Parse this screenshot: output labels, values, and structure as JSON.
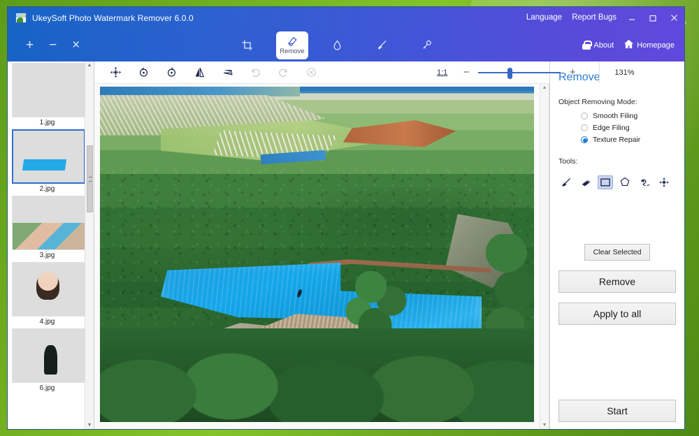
{
  "window": {
    "title": "UkeySoft Photo Watermark Remover 6.0.0",
    "app_icon": "photo-icon",
    "title_links": [
      "Language",
      "Report Bugs"
    ],
    "controls": {
      "minimize": "minimize-icon",
      "maximize": "maximize-icon",
      "close": "close-icon"
    },
    "accent_blue": "#1763c6",
    "accent_purple": "#5f49dc"
  },
  "navbar": {
    "file_ops": [
      {
        "name": "add-files-button",
        "glyph": "+"
      },
      {
        "name": "remove-file-button",
        "glyph": "−"
      },
      {
        "name": "clear-all-button",
        "glyph": "×"
      }
    ],
    "tabs": [
      {
        "id": "crop",
        "label": "",
        "icon": "crop-icon",
        "active": false
      },
      {
        "id": "remove",
        "label": "Remove",
        "icon": "eraser-icon",
        "active": true
      },
      {
        "id": "blur",
        "label": "",
        "icon": "droplet-icon",
        "active": false
      },
      {
        "id": "brush",
        "label": "",
        "icon": "brush-icon",
        "active": false
      },
      {
        "id": "key",
        "label": "",
        "icon": "key-icon",
        "active": false
      }
    ],
    "right_links": [
      {
        "label": "About",
        "icon": "lock-icon"
      },
      {
        "label": "Homepage",
        "icon": "home-icon"
      }
    ]
  },
  "thumbnails": {
    "items": [
      {
        "name": "1.jpg",
        "selected": false,
        "art": "t1"
      },
      {
        "name": "2.jpg",
        "selected": true,
        "art": "t2"
      },
      {
        "name": "3.jpg",
        "selected": false,
        "art": "t3"
      },
      {
        "name": "4.jpg",
        "selected": false,
        "art": "t4"
      },
      {
        "name": "6.jpg",
        "selected": false,
        "art": "t6"
      }
    ],
    "scroll_up": "▲",
    "scroll_down": "▼"
  },
  "canvas_toolbar": {
    "buttons": [
      {
        "name": "pan-tool-button",
        "icon": "move-icon",
        "disabled": false
      },
      {
        "name": "rotate-left-button",
        "icon": "rotate-ccw-icon",
        "disabled": false
      },
      {
        "name": "rotate-right-button",
        "icon": "rotate-cw-icon",
        "disabled": false
      },
      {
        "name": "flip-horizontal-button",
        "icon": "flip-h-icon",
        "disabled": false
      },
      {
        "name": "flip-vertical-button",
        "icon": "flip-v-icon",
        "disabled": false
      },
      {
        "name": "undo-button",
        "icon": "undo-icon",
        "disabled": true
      },
      {
        "name": "redo-button",
        "icon": "redo-icon",
        "disabled": true
      },
      {
        "name": "reset-button",
        "icon": "reset-circle-icon",
        "disabled": true
      }
    ],
    "fit_label": "1:1",
    "zoom_out": "−",
    "zoom_in": "+",
    "zoom_percent": "131%",
    "slider_value": 36
  },
  "photo": {
    "alt": "aerial view of an infinity swimming pool on a forested hillside overlooking a coastal town",
    "water_color": "#14a6ea",
    "forest_color": "#2a682f"
  },
  "right_panel": {
    "title": "Remove",
    "mode_label": "Object Removing Mode:",
    "modes": [
      {
        "label": "Smooth Filing",
        "selected": false
      },
      {
        "label": "Edge Filing",
        "selected": false
      },
      {
        "label": "Texture Repair",
        "selected": true
      }
    ],
    "tools_label": "Tools:",
    "tools": [
      {
        "name": "brush-tool",
        "icon": "brush-icon",
        "selected": false
      },
      {
        "name": "eraser-tool",
        "icon": "eraser-icon",
        "selected": false
      },
      {
        "name": "rectangle-tool",
        "icon": "rectangle-icon",
        "selected": true
      },
      {
        "name": "polygon-tool",
        "icon": "polygon-icon",
        "selected": false
      },
      {
        "name": "lasso-tool",
        "icon": "lasso-pen-icon",
        "selected": false
      },
      {
        "name": "move-tool",
        "icon": "move-icon",
        "selected": false
      }
    ],
    "clear_selected": "Clear Selected",
    "remove_button": "Remove",
    "apply_all_button": "Apply to all",
    "start_button": "Start"
  }
}
